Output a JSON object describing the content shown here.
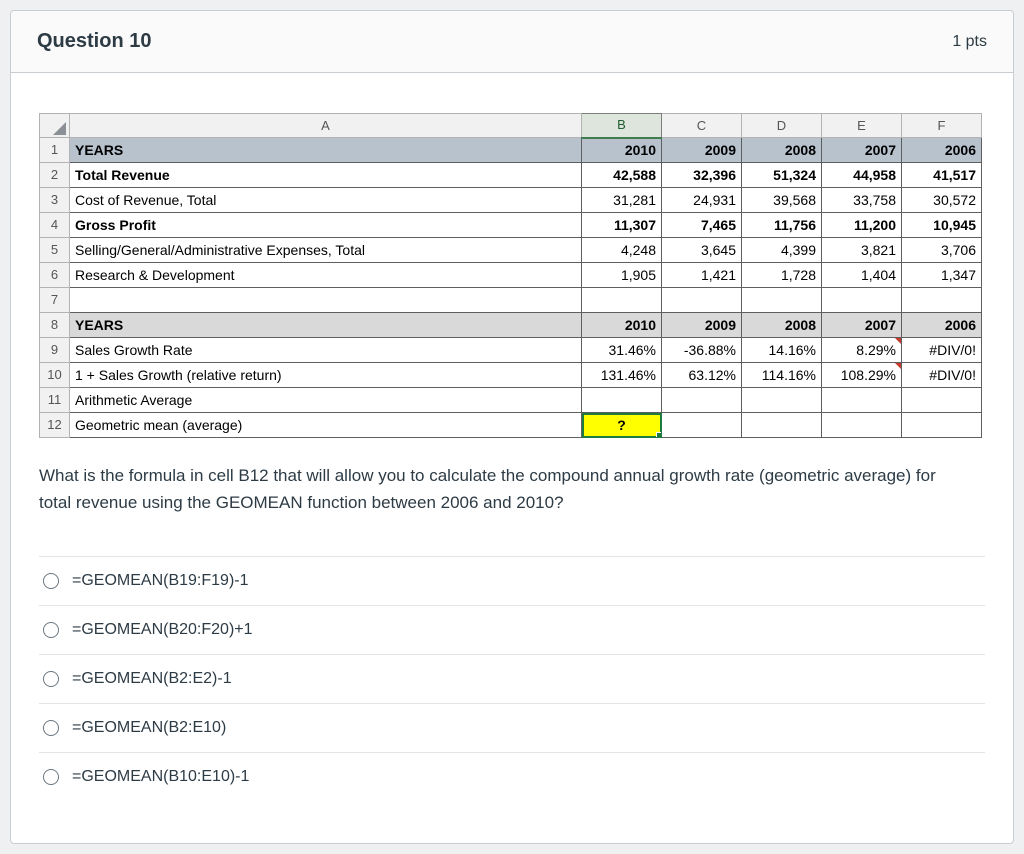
{
  "header": {
    "title": "Question 10",
    "points": "1 pts"
  },
  "colors": {
    "highlight_cell": "#ffff00",
    "selection_green": "#1f7a3f",
    "year_header_bg": "#b7c2cd",
    "gray_header_bg": "#d9d9d9",
    "error_flag_red": "#c43b2e"
  },
  "spreadsheet": {
    "column_headers": [
      "A",
      "B",
      "C",
      "D",
      "E",
      "F"
    ],
    "selected_column": "B",
    "rows": [
      {
        "num": "1",
        "label": "YEARS",
        "values": [
          "2010",
          "2009",
          "2008",
          "2007",
          "2006"
        ],
        "bg": "blue",
        "bold": true,
        "red_flags": [],
        "highlight_cell": null
      },
      {
        "num": "2",
        "label": "Total Revenue",
        "values": [
          "42,588",
          "32,396",
          "51,324",
          "44,958",
          "41,517"
        ],
        "bg": "",
        "bold": true,
        "red_flags": [],
        "highlight_cell": null
      },
      {
        "num": "3",
        "label": "Cost of Revenue, Total",
        "values": [
          "31,281",
          "24,931",
          "39,568",
          "33,758",
          "30,572"
        ],
        "bg": "",
        "bold": false,
        "red_flags": [],
        "highlight_cell": null
      },
      {
        "num": "4",
        "label": "Gross Profit",
        "values": [
          "11,307",
          "7,465",
          "11,756",
          "11,200",
          "10,945"
        ],
        "bg": "",
        "bold": true,
        "red_flags": [],
        "highlight_cell": null
      },
      {
        "num": "5",
        "label": "Selling/General/Administrative Expenses, Total",
        "values": [
          "4,248",
          "3,645",
          "4,399",
          "3,821",
          "3,706"
        ],
        "bg": "",
        "bold": false,
        "red_flags": [],
        "highlight_cell": null
      },
      {
        "num": "6",
        "label": "Research & Development",
        "values": [
          "1,905",
          "1,421",
          "1,728",
          "1,404",
          "1,347"
        ],
        "bg": "",
        "bold": false,
        "red_flags": [],
        "highlight_cell": null
      },
      {
        "num": "7",
        "label": "",
        "values": [
          "",
          "",
          "",
          "",
          ""
        ],
        "bg": "",
        "bold": false,
        "red_flags": [],
        "highlight_cell": null
      },
      {
        "num": "8",
        "label": "YEARS",
        "values": [
          "2010",
          "2009",
          "2008",
          "2007",
          "2006"
        ],
        "bg": "gray",
        "bold": true,
        "red_flags": [],
        "highlight_cell": null
      },
      {
        "num": "9",
        "label": "Sales Growth Rate",
        "values": [
          "31.46%",
          "-36.88%",
          "14.16%",
          "8.29%",
          "#DIV/0!"
        ],
        "bg": "",
        "bold": false,
        "red_flags": [
          3
        ],
        "highlight_cell": null
      },
      {
        "num": "10",
        "label": "1 + Sales Growth (relative return)",
        "values": [
          "131.46%",
          "63.12%",
          "114.16%",
          "108.29%",
          "#DIV/0!"
        ],
        "bg": "",
        "bold": false,
        "red_flags": [
          3
        ],
        "highlight_cell": null
      },
      {
        "num": "11",
        "label": "Arithmetic Average",
        "values": [
          "",
          "",
          "",
          "",
          ""
        ],
        "bg": "",
        "bold": false,
        "red_flags": [],
        "highlight_cell": null
      },
      {
        "num": "12",
        "label": "Geometric mean (average)",
        "values": [
          "?",
          "",
          "",
          "",
          ""
        ],
        "bg": "",
        "bold": false,
        "red_flags": [],
        "highlight_cell": 0
      }
    ]
  },
  "question": {
    "text": "What is the formula in cell B12 that will allow you to calculate the compound annual growth rate (geometric average) for total revenue using the GEOMEAN function between 2006 and 2010?"
  },
  "options": [
    {
      "label": "=GEOMEAN(B19:F19)-1"
    },
    {
      "label": "=GEOMEAN(B20:F20)+1"
    },
    {
      "label": "=GEOMEAN(B2:E2)-1"
    },
    {
      "label": "=GEOMEAN(B2:E10)"
    },
    {
      "label": "=GEOMEAN(B10:E10)-1"
    }
  ]
}
